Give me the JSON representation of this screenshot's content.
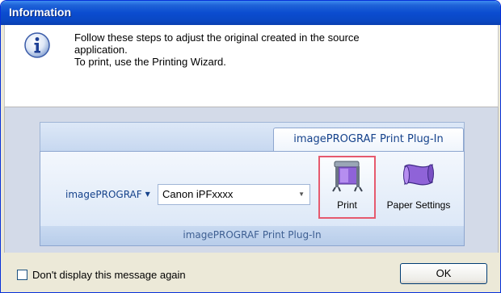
{
  "window": {
    "title": "Information"
  },
  "message": {
    "icon": "info-icon",
    "lines": [
      "Follow these steps to adjust the original created in the source",
      "application.",
      "To print, use the Printing Wizard."
    ]
  },
  "ribbon": {
    "tab_label": "imagePROGRAF Print Plug-In",
    "printer_label": "imagePROGRAF",
    "printer_value": "Canon iPFxxxx",
    "buttons": {
      "print_label": "Print",
      "paper_settings_label": "Paper Settings"
    },
    "group_label": "imagePROGRAF Print Plug-In"
  },
  "footer": {
    "checkbox_label": "Don't display this message again",
    "checkbox_checked": false,
    "ok_label": "OK"
  },
  "colors": {
    "titlebar": "#0b4cd0",
    "highlight_border": "#e65a6e",
    "ribbon_text": "#15428b"
  }
}
